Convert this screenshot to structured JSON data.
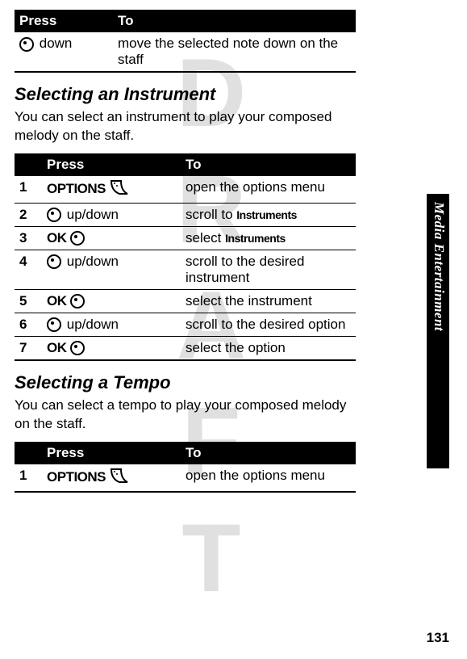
{
  "watermark": "DRAFT",
  "side_tab": "Media Entertainment",
  "page_number": "131",
  "table1": {
    "header_press": "Press",
    "header_to": "To",
    "rows": [
      {
        "press_label": "down",
        "to": "move the selected note down on the staff"
      }
    ]
  },
  "section1": {
    "heading": "Selecting an Instrument",
    "body": "You can select an instrument to play your composed melody on the staff."
  },
  "table2": {
    "header_press": "Press",
    "header_to": "To",
    "rows": [
      {
        "num": "1",
        "press_bold": "OPTIONS",
        "press_icon": "soft",
        "to": "open the options menu"
      },
      {
        "num": "2",
        "press_icon": "dial",
        "press_label": "up/down",
        "to_prefix": "scroll to ",
        "to_bold": "Instruments"
      },
      {
        "num": "3",
        "press_bold": "OK",
        "press_icon": "dial",
        "to_prefix": "select ",
        "to_bold": "Instruments"
      },
      {
        "num": "4",
        "press_icon": "dial",
        "press_label": "up/down",
        "to": "scroll to the desired instrument"
      },
      {
        "num": "5",
        "press_bold": "OK",
        "press_icon": "dial",
        "to": "select the instrument"
      },
      {
        "num": "6",
        "press_icon": "dial",
        "press_label": "up/down",
        "to": "scroll to the desired option"
      },
      {
        "num": "7",
        "press_bold": "OK",
        "press_icon": "dial",
        "to": "select the option"
      }
    ]
  },
  "section2": {
    "heading": "Selecting a Tempo",
    "body": "You can select a tempo to play your composed melody on the staff."
  },
  "table3": {
    "header_press": "Press",
    "header_to": "To",
    "rows": [
      {
        "num": "1",
        "press_bold": "OPTIONS",
        "press_icon": "soft",
        "to": "open the options menu"
      }
    ]
  }
}
